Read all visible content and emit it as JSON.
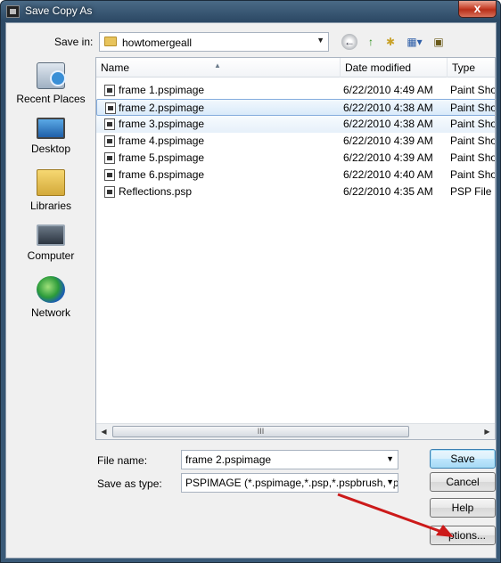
{
  "window": {
    "title": "Save Copy As",
    "close_label": "x"
  },
  "toolbar": {
    "save_in_label": "Save in:",
    "save_in_value": "howtomergeall",
    "back_icon": "back-arrow-icon",
    "up_icon": "up-folder-icon",
    "new_folder_icon": "new-folder-icon",
    "views_icon": "views-menu-icon"
  },
  "places": [
    {
      "label": "Recent Places",
      "icon": "recent-places-icon"
    },
    {
      "label": "Desktop",
      "icon": "desktop-icon"
    },
    {
      "label": "Libraries",
      "icon": "libraries-icon"
    },
    {
      "label": "Computer",
      "icon": "computer-icon"
    },
    {
      "label": "Network",
      "icon": "network-icon"
    }
  ],
  "columns": {
    "name": "Name",
    "date": "Date modified",
    "type": "Type"
  },
  "files": [
    {
      "name": "frame 1.pspimage",
      "date": "6/22/2010 4:49 AM",
      "type": "Paint Shop"
    },
    {
      "name": "frame 2.pspimage",
      "date": "6/22/2010 4:38 AM",
      "type": "Paint Shop"
    },
    {
      "name": "frame 3.pspimage",
      "date": "6/22/2010 4:38 AM",
      "type": "Paint Shop"
    },
    {
      "name": "frame 4.pspimage",
      "date": "6/22/2010 4:39 AM",
      "type": "Paint Shop"
    },
    {
      "name": "frame 5.pspimage",
      "date": "6/22/2010 4:39 AM",
      "type": "Paint Shop"
    },
    {
      "name": "frame 6.pspimage",
      "date": "6/22/2010 4:40 AM",
      "type": "Paint Shop"
    },
    {
      "name": "Reflections.psp",
      "date": "6/22/2010 4:35 AM",
      "type": "PSP File"
    }
  ],
  "form": {
    "file_name_label": "File name:",
    "file_name_value": "frame 2.pspimage",
    "save_type_label": "Save as type:",
    "save_type_value": "PSPIMAGE (*.pspimage,*.psp,*.pspbrush,*.pspf"
  },
  "buttons": {
    "save": "Save",
    "cancel": "Cancel",
    "help": "Help",
    "options": "ptions..."
  },
  "scrollbar": {
    "thumb_grip": "III"
  },
  "annotation": {
    "arrow_color": "#cc1a1a"
  }
}
